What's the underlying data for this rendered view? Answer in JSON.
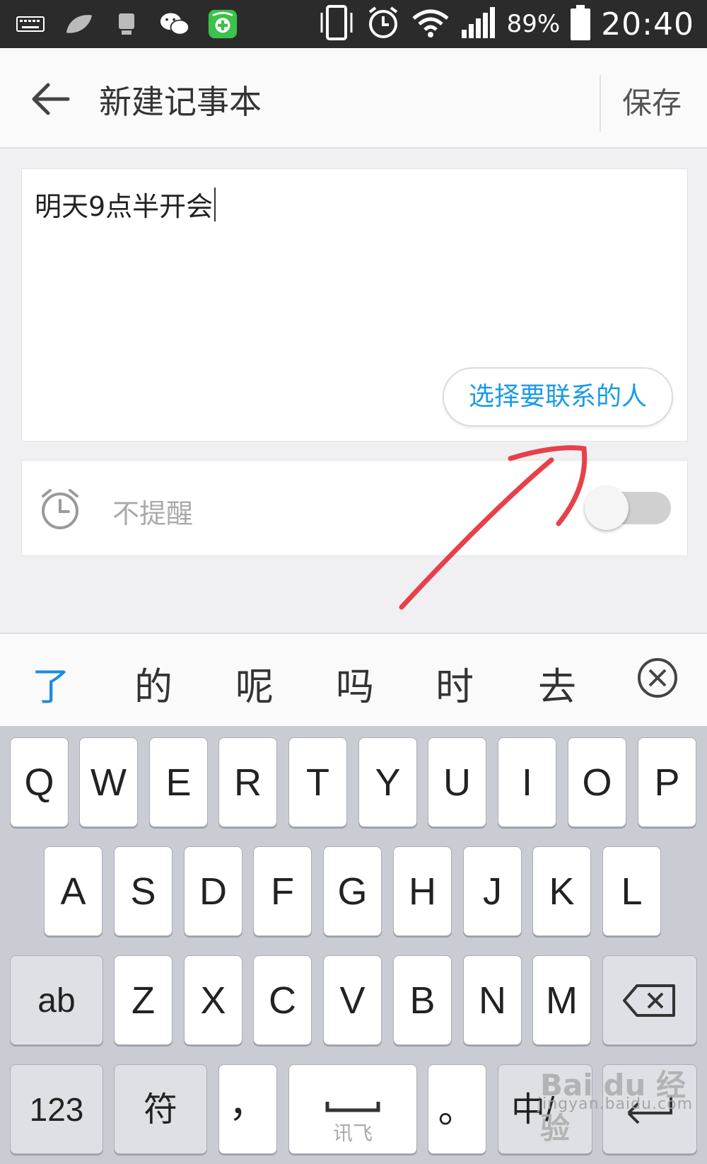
{
  "status_bar": {
    "battery_percent": "89%",
    "time": "20:40",
    "icons": [
      "keyboard-icon",
      "leaf-icon",
      "device-icon",
      "wechat-icon",
      "security-app-icon",
      "vibrate-icon",
      "alarm-icon",
      "wifi-icon",
      "signal-icon",
      "battery-icon"
    ]
  },
  "app_bar": {
    "title": "新建记事本",
    "save_label": "保存",
    "back_icon": "arrow-left-icon"
  },
  "note": {
    "text": "明天9点半开会",
    "contact_button_label": "选择要联系的人"
  },
  "reminder": {
    "label": "不提醒",
    "icon": "alarm-clock-icon",
    "enabled": false
  },
  "candidates": {
    "items": [
      "了",
      "的",
      "呢",
      "吗",
      "时",
      "去"
    ],
    "active_index": 0,
    "close_icon": "circle-x-icon"
  },
  "keyboard": {
    "row1": [
      "Q",
      "W",
      "E",
      "R",
      "T",
      "Y",
      "U",
      "I",
      "O",
      "P"
    ],
    "row2": [
      "A",
      "S",
      "D",
      "F",
      "G",
      "H",
      "J",
      "K",
      "L"
    ],
    "row3": [
      "Z",
      "X",
      "C",
      "V",
      "B",
      "N",
      "M"
    ],
    "ab_label": "ab",
    "num_label": "123",
    "symbol_label": "符",
    "comma_label": "，",
    "space_sublabel": "讯飞",
    "period_label": "。",
    "lang_label": "中/",
    "backspace_icon": "backspace-icon",
    "enter_icon": "enter-icon"
  },
  "watermark": {
    "logo": "Bai du 经验",
    "url": "jingyan.baidu.com"
  },
  "colors": {
    "accent": "#1a9be6",
    "annotation": "#e8404a",
    "status_bar_bg": "#2b2b2b"
  }
}
